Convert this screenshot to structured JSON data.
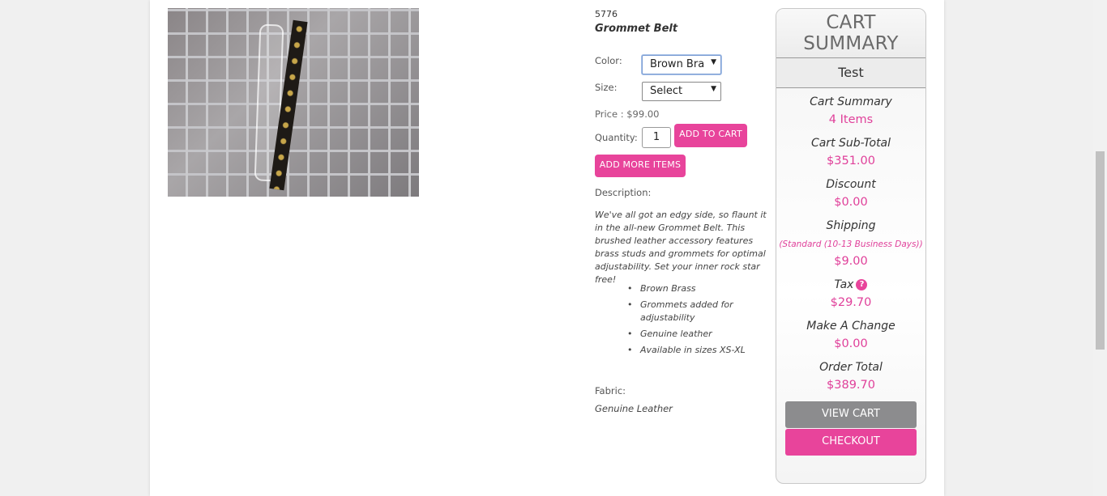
{
  "product": {
    "sku": "5776",
    "name": "Grommet Belt",
    "color_label": "Color:",
    "color_value": "Brown Bra",
    "size_label": "Size:",
    "size_value": "Select",
    "price_text": "Price : $99.00",
    "quantity_label": "Quantity:",
    "quantity_value": "1",
    "add_to_cart_label": "ADD TO CART",
    "add_more_label": "ADD MORE ITEMS",
    "description_label": "Description:",
    "description_text": "We've all got an edgy side, so flaunt it in the all-new Grommet Belt. This brushed leather accessory features brass studs and grommets for optimal adjustability. Set your inner rock star free!",
    "bullets": [
      "Brown Brass",
      "Grommets added for adjustability",
      "Genuine leather",
      "Available in sizes XS-XL"
    ],
    "fabric_label": "Fabric:",
    "fabric_value": "Genuine Leather"
  },
  "cart": {
    "title": "CART SUMMARY",
    "user": "Test",
    "summary_label": "Cart Summary",
    "summary_value": "4 Items",
    "subtotal_label": "Cart Sub-Total",
    "subtotal_value": "$351.00",
    "discount_label": "Discount",
    "discount_value": "$0.00",
    "shipping_label": "Shipping",
    "shipping_method": "(Standard (10-13 Business Days))",
    "shipping_value": "$9.00",
    "tax_label": "Tax",
    "tax_help": "?",
    "tax_value": "$29.70",
    "change_label": "Make A Change",
    "change_value": "$0.00",
    "total_label": "Order Total",
    "total_value": "$389.70",
    "view_cart_label": "VIEW CART",
    "checkout_label": "CHECKOUT"
  },
  "colors": {
    "accent": "#e8449b",
    "view_cart_bg": "#8c8c8e"
  }
}
